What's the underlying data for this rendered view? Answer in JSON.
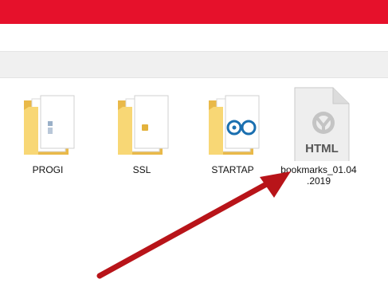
{
  "colors": {
    "title_bar": "#e6112b",
    "folder": "#f8d775",
    "folder_dark": "#e9b949",
    "arrow": "#b81419",
    "page_blue": "#1a6fb0"
  },
  "items": [
    {
      "name": "PROGI",
      "icon": "folder-icon"
    },
    {
      "name": "SSL",
      "icon": "folder-icon"
    },
    {
      "name": "STARTAP",
      "icon": "folder-icon"
    },
    {
      "name": "bookmarks_01.04\n.2019",
      "icon": "html-file-icon",
      "badge": "HTML"
    }
  ]
}
